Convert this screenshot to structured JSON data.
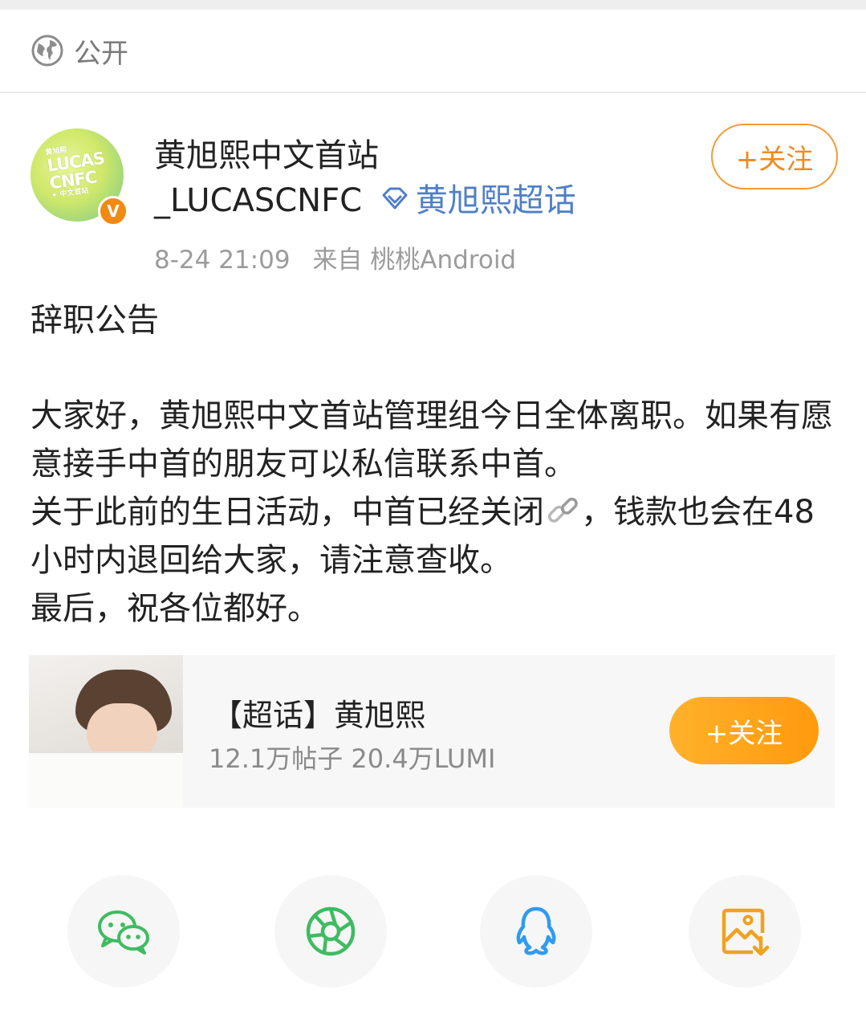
{
  "header": {
    "visibility": "公开"
  },
  "post": {
    "author_name_line1": "黄旭熙中文首站",
    "author_name_line2": "_LUCASCNFC",
    "super_topic": "黄旭熙超话",
    "avatar_text": "LUCAS CNFC",
    "avatar_small_top": "黄旭熙",
    "avatar_small_bottom": "✦ 中文首站",
    "verified_badge": "V",
    "time": "8-24 21:09",
    "source": "来自 桃桃Android",
    "follow_label": "+关注",
    "title": "辞职公告",
    "body": {
      "p1": "大家好，黄旭熙中文首站管理组今日全体离职。如果有愿意接手中首的朋友可以私信联系中首。",
      "p2a": "关于此前的生日活动，中首已经关闭",
      "p2b": "，钱款也会在48小时内退回给大家，请注意查收。",
      "p3": "最后，祝各位都好。"
    }
  },
  "topic_card": {
    "title": "【超话】黄旭熙",
    "stats": "12.1万帖子 20.4万LUMI",
    "follow_label": "+关注"
  },
  "share": {
    "icons": [
      "wechat-icon",
      "moments-icon",
      "qq-icon",
      "save-image-icon"
    ]
  },
  "colors": {
    "accent_orange": "#f08a1e",
    "topic_blue": "#4f7fc8",
    "wechat_green": "#3fbb62",
    "qq_blue": "#2f9bf0",
    "save_orange": "#f0a21e"
  }
}
